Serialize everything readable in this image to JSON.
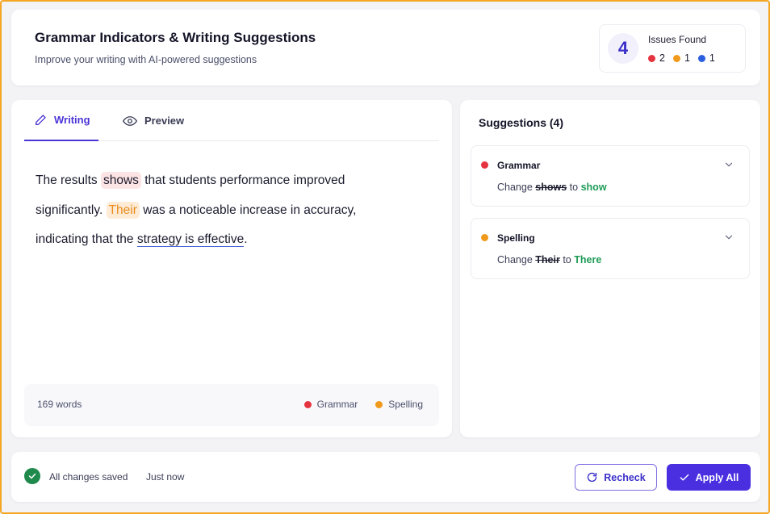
{
  "header": {
    "title": "Grammar Indicators & Writing Suggestions",
    "subtitle": "Improve your writing with AI-powered suggestions",
    "issues": {
      "count": "4",
      "label": "Issues Found",
      "stats": [
        {
          "color": "#e5343f",
          "value": "2"
        },
        {
          "color": "#f09a1c",
          "value": "1"
        },
        {
          "color": "#2c5fe0",
          "value": "1"
        }
      ]
    }
  },
  "editor": {
    "tabs": [
      {
        "label": "Writing",
        "icon": "pencil-icon",
        "active": true
      },
      {
        "label": "Preview",
        "icon": "eye-icon",
        "active": false
      }
    ],
    "text": {
      "p1": "The results ",
      "err1": "shows",
      "p2": " that students performance improved significantly. ",
      "err2": "Their",
      "p3": " was a noticeable increase in accuracy, indicating that the ",
      "err3": "strategy is effective",
      "p4": "."
    },
    "word_count": "169 words",
    "legend": [
      {
        "label": "Grammar",
        "color": "#e5343f"
      },
      {
        "label": "Spelling",
        "color": "#f09a1c"
      }
    ]
  },
  "suggestions": {
    "title": "Suggestions (4)",
    "items": [
      {
        "label": "Grammar",
        "color": "#e5343f",
        "prefix": "Change",
        "old": "shows",
        "to": "to",
        "new": "show"
      },
      {
        "label": "Spelling",
        "color": "#f09a1c",
        "prefix": "Change",
        "old": "Their",
        "to": "to",
        "new": "There"
      }
    ]
  },
  "status": {
    "saved": "All changes saved",
    "time": "Just now"
  },
  "actions": {
    "recheck": "Recheck",
    "apply_all": "Apply All"
  },
  "colors": {
    "accent": "#4a2fe0",
    "success": "#1f8a4c"
  }
}
